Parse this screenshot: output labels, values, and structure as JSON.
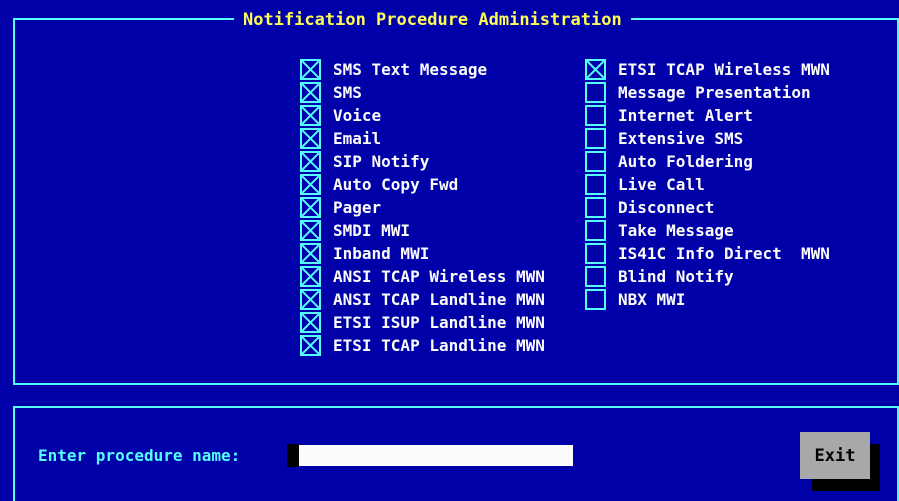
{
  "window": {
    "title": "Notification Procedure Administration"
  },
  "colors": {
    "background": "#0000a8",
    "border": "#54fcfc",
    "title": "#fcfc54",
    "label": "#fcfcfc",
    "input_bg": "#fcfcfc",
    "button_bg": "#a8a8a8"
  },
  "procedures_left": [
    {
      "label": "SMS Text Message",
      "checked": true
    },
    {
      "label": "SMS",
      "checked": true
    },
    {
      "label": "Voice",
      "checked": true
    },
    {
      "label": "Email",
      "checked": true
    },
    {
      "label": "SIP Notify",
      "checked": true
    },
    {
      "label": "Auto Copy Fwd",
      "checked": true
    },
    {
      "label": "Pager",
      "checked": true
    },
    {
      "label": "SMDI MWI",
      "checked": true
    },
    {
      "label": "Inband MWI",
      "checked": true
    },
    {
      "label": "ANSI TCAP Wireless MWN",
      "checked": true
    },
    {
      "label": "ANSI TCAP Landline MWN",
      "checked": true
    },
    {
      "label": "ETSI ISUP Landline MWN",
      "checked": true
    },
    {
      "label": "ETSI TCAP Landline MWN",
      "checked": true
    }
  ],
  "procedures_right": [
    {
      "label": "ETSI TCAP Wireless MWN",
      "checked": true
    },
    {
      "label": "Message Presentation",
      "checked": false
    },
    {
      "label": "Internet Alert",
      "checked": false
    },
    {
      "label": "Extensive SMS",
      "checked": false
    },
    {
      "label": "Auto Foldering",
      "checked": false
    },
    {
      "label": "Live Call",
      "checked": false
    },
    {
      "label": "Disconnect",
      "checked": false
    },
    {
      "label": "Take Message",
      "checked": false
    },
    {
      "label": "IS41C Info Direct  MWN",
      "checked": false
    },
    {
      "label": "Blind Notify",
      "checked": false
    },
    {
      "label": "NBX MWI",
      "checked": false
    }
  ],
  "form": {
    "prompt_label": "Enter procedure name:",
    "input_value": "",
    "exit_label": "Exit"
  }
}
